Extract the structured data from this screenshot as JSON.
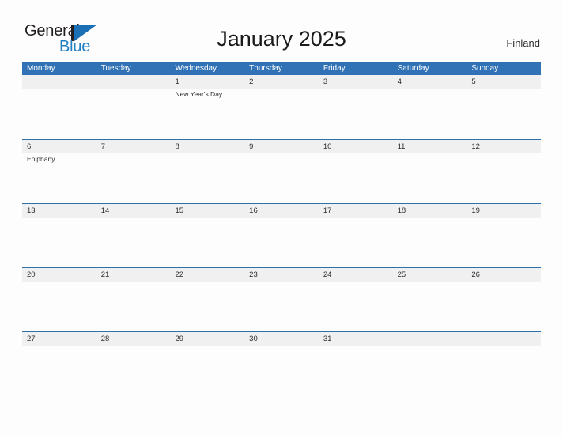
{
  "brand": {
    "name_part1": "General",
    "name_part2": "Blue",
    "logo_icon": "triangle-flag-icon",
    "accent_color": "#1b6fb5",
    "dark_color": "#231f20"
  },
  "header": {
    "title": "January 2025",
    "region": "Finland"
  },
  "colors": {
    "header_blue": "#3072b5",
    "row_band_gray": "#f0f0f0",
    "row_divider_blue": "#2f6fa8",
    "page_background": "#fdfdfd",
    "text": "#2b2b2b"
  },
  "calendar": {
    "weekday_headers": [
      "Monday",
      "Tuesday",
      "Wednesday",
      "Thursday",
      "Friday",
      "Saturday",
      "Sunday"
    ],
    "weeks": [
      {
        "days": [
          {
            "date": "",
            "events": []
          },
          {
            "date": "",
            "events": []
          },
          {
            "date": "1",
            "events": [
              "New Year's Day"
            ]
          },
          {
            "date": "2",
            "events": []
          },
          {
            "date": "3",
            "events": []
          },
          {
            "date": "4",
            "events": []
          },
          {
            "date": "5",
            "events": []
          }
        ]
      },
      {
        "days": [
          {
            "date": "6",
            "events": [
              "Epiphany"
            ]
          },
          {
            "date": "7",
            "events": []
          },
          {
            "date": "8",
            "events": []
          },
          {
            "date": "9",
            "events": []
          },
          {
            "date": "10",
            "events": []
          },
          {
            "date": "11",
            "events": []
          },
          {
            "date": "12",
            "events": []
          }
        ]
      },
      {
        "days": [
          {
            "date": "13",
            "events": []
          },
          {
            "date": "14",
            "events": []
          },
          {
            "date": "15",
            "events": []
          },
          {
            "date": "16",
            "events": []
          },
          {
            "date": "17",
            "events": []
          },
          {
            "date": "18",
            "events": []
          },
          {
            "date": "19",
            "events": []
          }
        ]
      },
      {
        "days": [
          {
            "date": "20",
            "events": []
          },
          {
            "date": "21",
            "events": []
          },
          {
            "date": "22",
            "events": []
          },
          {
            "date": "23",
            "events": []
          },
          {
            "date": "24",
            "events": []
          },
          {
            "date": "25",
            "events": []
          },
          {
            "date": "26",
            "events": []
          }
        ]
      },
      {
        "days": [
          {
            "date": "27",
            "events": []
          },
          {
            "date": "28",
            "events": []
          },
          {
            "date": "29",
            "events": []
          },
          {
            "date": "30",
            "events": []
          },
          {
            "date": "31",
            "events": []
          },
          {
            "date": "",
            "events": []
          },
          {
            "date": "",
            "events": []
          }
        ]
      }
    ]
  }
}
